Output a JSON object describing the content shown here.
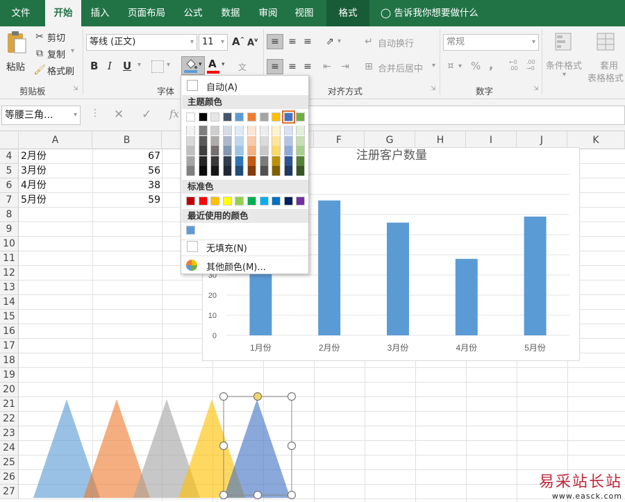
{
  "tabs": {
    "file": "文件",
    "home": "开始",
    "insert": "插入",
    "layout": "页面布局",
    "formula": "公式",
    "data": "数据",
    "review": "审阅",
    "view": "视图",
    "format": "格式"
  },
  "tell_me": "告诉我你想要做什么",
  "ribbon": {
    "paste": "粘贴",
    "cut": "剪切",
    "copy": "复制",
    "painter": "格式刷",
    "clipboard": "剪贴板",
    "font_name": "等线 (正文)",
    "font_size": "11",
    "bold": "B",
    "italic": "I",
    "underline": "U",
    "font_group": "字体",
    "font_grow": "A",
    "font_shrink": "A",
    "font_color_glyph": "A",
    "wrap": "自动换行",
    "merge": "合并后居中",
    "align_group": "对齐方式",
    "num_format": "常规",
    "pct": "%",
    "comma": ",",
    "num_group": "数字",
    "cond_fmt": "条件格式",
    "table_fmt_1": "套用",
    "table_fmt_2": "表格格式"
  },
  "name_box": "等腰三角...",
  "fx": "fx",
  "columns": [
    "A",
    "B",
    "C",
    "D",
    "E",
    "F",
    "G",
    "H",
    "I",
    "J",
    "K"
  ],
  "rows": [
    "4",
    "5",
    "6",
    "7",
    "8",
    "9",
    "10",
    "11",
    "12",
    "13",
    "14",
    "15",
    "16",
    "17",
    "18",
    "19",
    "20",
    "21",
    "22",
    "23",
    "24",
    "25",
    "26",
    "27"
  ],
  "cells": [
    {
      "label": "2月份",
      "value": "67"
    },
    {
      "label": "3月份",
      "value": "56"
    },
    {
      "label": "4月份",
      "value": "38"
    },
    {
      "label": "5月份",
      "value": "59"
    }
  ],
  "chart_data": {
    "type": "bar",
    "title": "注册客户数量",
    "categories": [
      "1月份",
      "2月份",
      "3月份",
      "4月份",
      "5月份"
    ],
    "values": [
      32,
      67,
      56,
      38,
      59
    ],
    "ylim": [
      0,
      80
    ],
    "yticks": [
      "0",
      "10",
      "20",
      "30"
    ],
    "bar_color": "#5b9bd5",
    "grid": true
  },
  "palette": {
    "auto": "自动(A)",
    "theme_header": "主题颜色",
    "theme_top": [
      "#ffffff",
      "#000000",
      "#e7e6e6",
      "#44546a",
      "#5b9bd5",
      "#ed7d31",
      "#a5a5a5",
      "#ffc000",
      "#4472c4",
      "#70ad47"
    ],
    "theme_shades": [
      [
        "#f2f2f2",
        "#7f7f7f",
        "#d0cece",
        "#d6dce4",
        "#deebf6",
        "#fbe5d5",
        "#ededed",
        "#fff2cc",
        "#d9e2f3",
        "#e2efd9"
      ],
      [
        "#d8d8d8",
        "#595959",
        "#aeabab",
        "#adb9ca",
        "#bdd7ee",
        "#f7cbac",
        "#dbdbdb",
        "#fee599",
        "#b4c6e7",
        "#c5e0b3"
      ],
      [
        "#bfbfbf",
        "#3f3f3f",
        "#757070",
        "#8496b0",
        "#9dc3e6",
        "#f4b183",
        "#c9c9c9",
        "#ffd965",
        "#8eaadb",
        "#a8d08d"
      ],
      [
        "#a5a5a5",
        "#262626",
        "#3a3838",
        "#323f4f",
        "#2e75b5",
        "#c45911",
        "#7b7b7b",
        "#bf9000",
        "#2f5496",
        "#538135"
      ],
      [
        "#7f7f7f",
        "#0c0c0c",
        "#171616",
        "#222a35",
        "#1e4e79",
        "#833c0b",
        "#525252",
        "#7f6000",
        "#1f3864",
        "#375623"
      ]
    ],
    "standard_header": "标准色",
    "standard": [
      "#c00000",
      "#ff0000",
      "#ffc000",
      "#ffff00",
      "#92d050",
      "#00b050",
      "#00b0f0",
      "#0070c0",
      "#002060",
      "#7030a0"
    ],
    "recent_header": "最近使用的颜色",
    "recent": [
      "#5b9bd5"
    ],
    "no_fill": "无填充(N)",
    "more": "其他颜色(M)..."
  },
  "shapes": {
    "triangle_colors": [
      "#5b9bd5",
      "#ed7d31",
      "#a5a5a5",
      "#ffc000",
      "#4472c4"
    ]
  },
  "watermark": {
    "title": "易采站长站",
    "url": "www.easck.com"
  }
}
